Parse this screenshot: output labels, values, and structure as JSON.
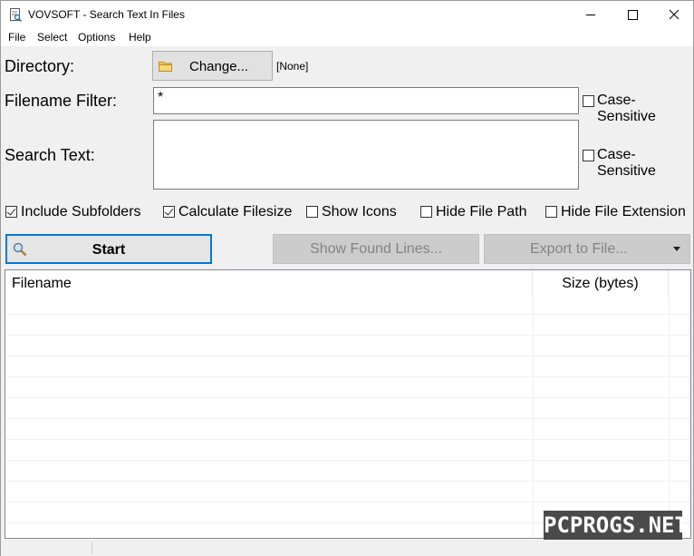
{
  "window": {
    "title": "VOVSOFT - Search Text In Files"
  },
  "menu": [
    {
      "label": "File"
    },
    {
      "label": "Select"
    },
    {
      "label": "Options"
    },
    {
      "label": "Help"
    }
  ],
  "directory": {
    "label": "Directory:",
    "change_button": "Change...",
    "value": "[None]"
  },
  "filename_filter": {
    "label": "Filename Filter:",
    "value": "*",
    "case_sensitive_label": "Case-Sensitive",
    "case_sensitive": false
  },
  "search_text": {
    "label": "Search Text:",
    "value": "",
    "case_sensitive_label": "Case-Sensitive",
    "case_sensitive": false
  },
  "options": [
    {
      "label": "Include Subfolders",
      "checked": true
    },
    {
      "label": "Calculate Filesize",
      "checked": true
    },
    {
      "label": "Show Icons",
      "checked": false
    },
    {
      "label": "Hide File Path",
      "checked": false
    },
    {
      "label": "Hide File Extension",
      "checked": false
    }
  ],
  "actions": {
    "start": "Start",
    "show_found_lines": "Show Found Lines...",
    "export": "Export to File..."
  },
  "results": {
    "columns": [
      "Filename",
      "Size (bytes)"
    ],
    "rows": []
  },
  "watermark": "PCPROGS.NET",
  "colors": {
    "accent": "#0078d7",
    "disabled_bg": "#cccccc",
    "disabled_text": "#838383"
  }
}
